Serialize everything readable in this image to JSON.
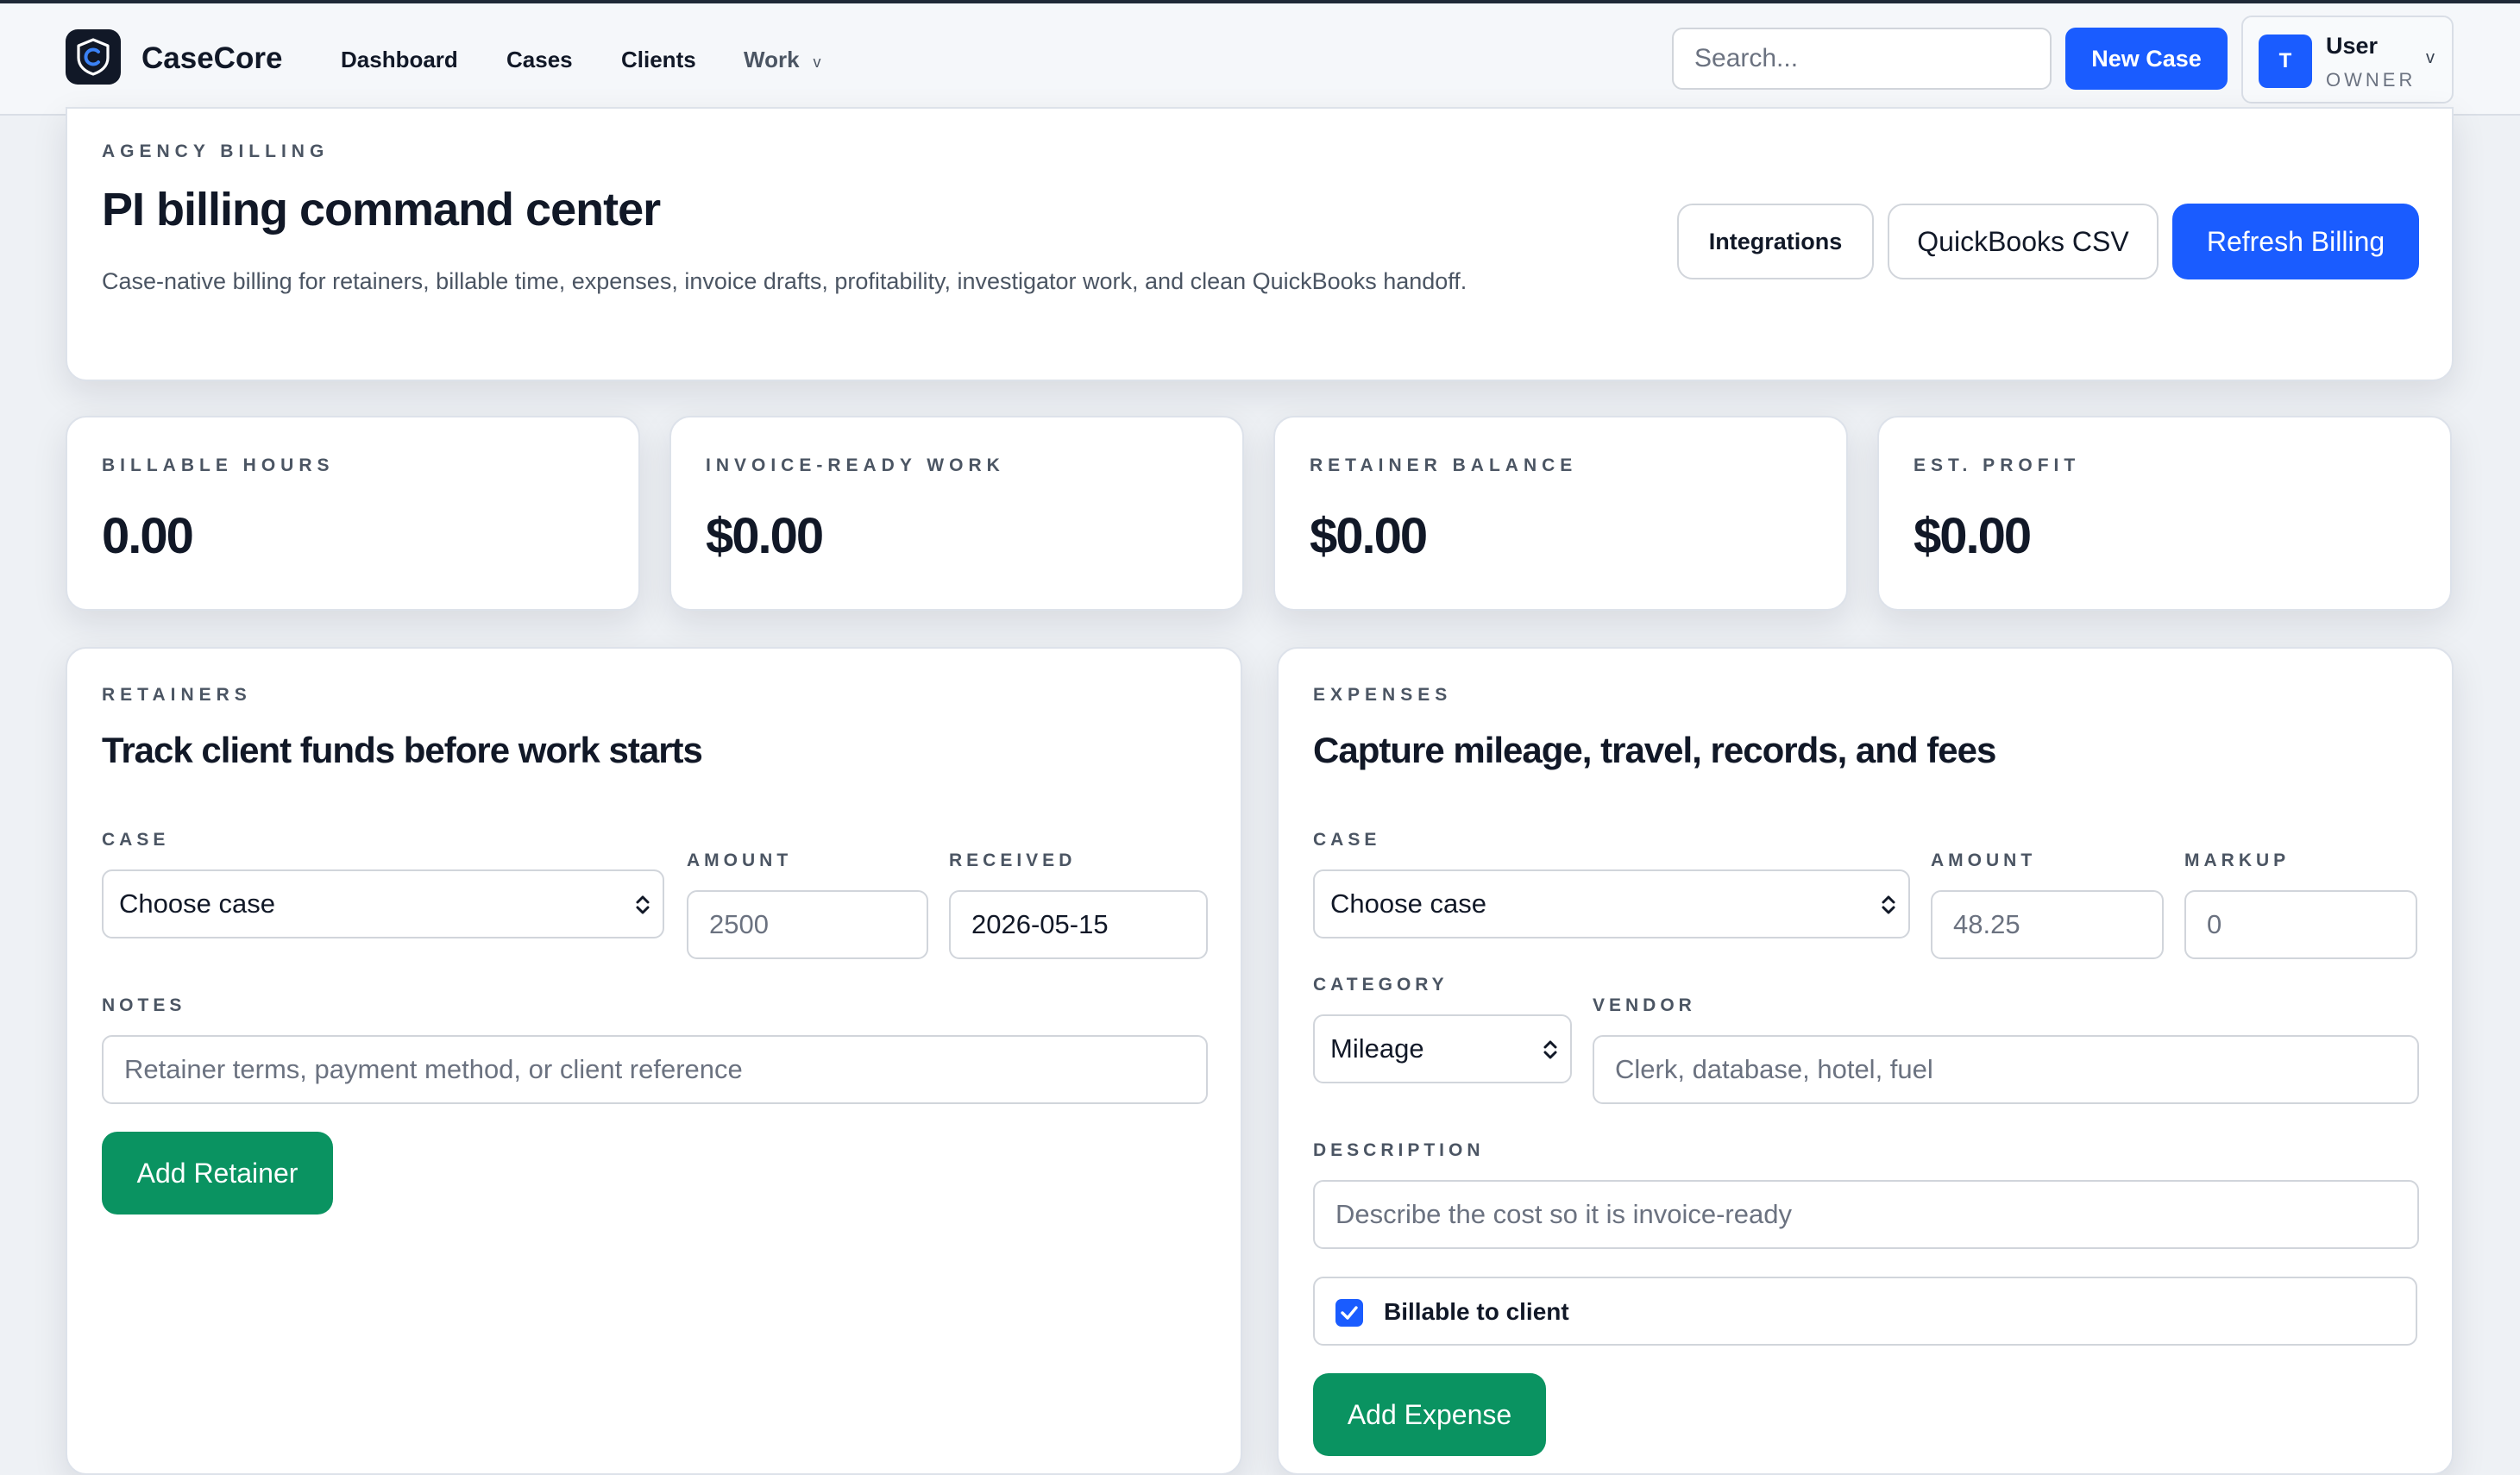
{
  "header": {
    "brand": "CaseCore",
    "nav": [
      "Dashboard",
      "Cases",
      "Clients",
      "Work"
    ],
    "search_placeholder": "Search...",
    "new_case_label": "New Case",
    "user": {
      "initial": "T",
      "name": "User",
      "role": "OWNER",
      "chevron": "v"
    },
    "work_chevron": "v"
  },
  "hero": {
    "eyebrow": "AGENCY BILLING",
    "title": "PI billing command center",
    "subtitle": "Case-native billing for retainers, billable time, expenses, invoice drafts, profitability, investigator work, and clean QuickBooks handoff.",
    "buttons": {
      "integrations": "Integrations",
      "quickbooks": "QuickBooks CSV",
      "refresh": "Refresh Billing"
    }
  },
  "stats": [
    {
      "label": "BILLABLE HOURS",
      "value": "0.00"
    },
    {
      "label": "INVOICE-READY WORK",
      "value": "$0.00"
    },
    {
      "label": "RETAINER BALANCE",
      "value": "$0.00"
    },
    {
      "label": "EST. PROFIT",
      "value": "$0.00"
    }
  ],
  "retainers": {
    "eyebrow": "RETAINERS",
    "title": "Track client funds before work starts",
    "case_label": "CASE",
    "case_value": "Choose case",
    "amount_label": "AMOUNT",
    "amount_placeholder": "2500",
    "received_label": "RECEIVED",
    "received_value": "2026-05-15",
    "notes_label": "NOTES",
    "notes_placeholder": "Retainer terms, payment method, or client reference",
    "submit_label": "Add Retainer"
  },
  "expenses": {
    "eyebrow": "EXPENSES",
    "title": "Capture mileage, travel, records, and fees",
    "case_label": "CASE",
    "case_value": "Choose case",
    "amount_label": "AMOUNT",
    "amount_placeholder": "48.25",
    "markup_label": "MARKUP",
    "markup_placeholder": "0",
    "category_label": "CATEGORY",
    "category_value": "Mileage",
    "vendor_label": "VENDOR",
    "vendor_placeholder": "Clerk, database, hotel, fuel",
    "description_label": "DESCRIPTION",
    "description_placeholder": "Describe the cost so it is invoice-ready",
    "billable_label": "Billable to client",
    "billable_checked": true,
    "submit_label": "Add Expense"
  },
  "colors": {
    "primary": "#1a5cff",
    "success": "#0a9361",
    "dark": "#111827"
  }
}
